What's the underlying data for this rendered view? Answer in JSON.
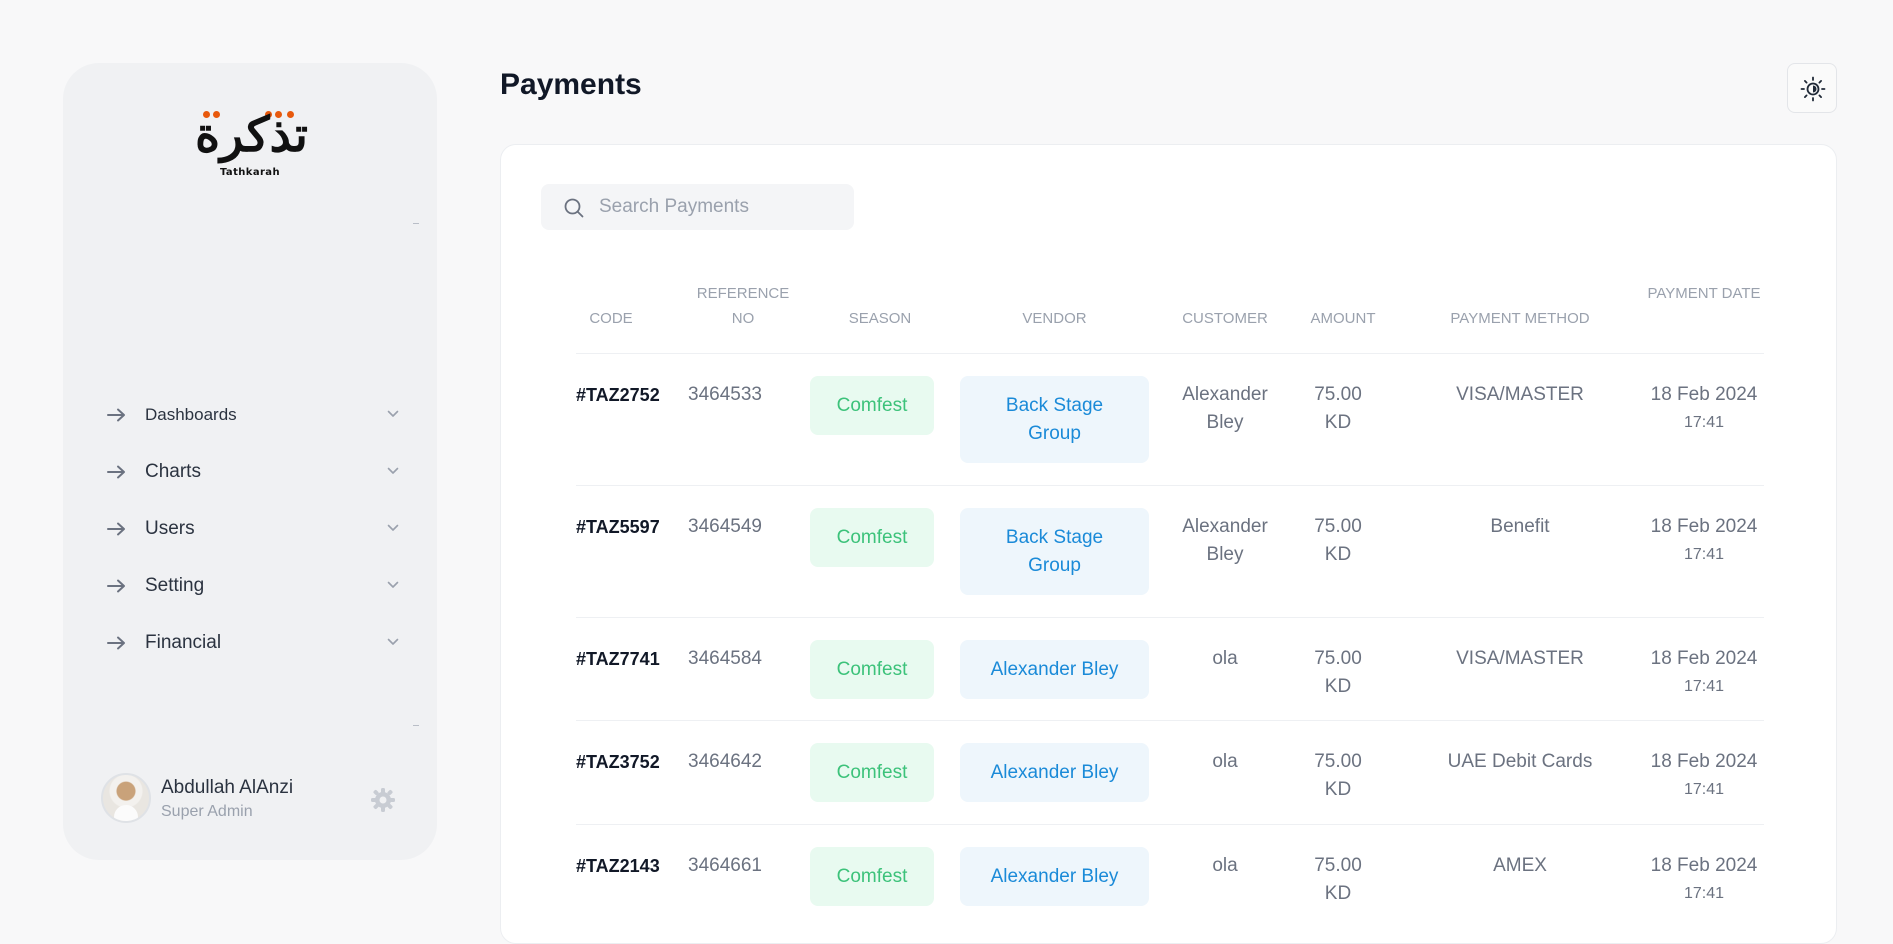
{
  "brand": {
    "logo_word": "تذكرة",
    "logo_sub": "Tathkarah"
  },
  "sidebar": {
    "items": [
      {
        "label": "Dashboards"
      },
      {
        "label": "Charts"
      },
      {
        "label": "Users"
      },
      {
        "label": "Setting"
      },
      {
        "label": "Financial"
      }
    ]
  },
  "user": {
    "name": "Abdullah AlAnzi",
    "role": "Super Admin"
  },
  "page": {
    "title": "Payments"
  },
  "search": {
    "placeholder": "Search Payments",
    "value": ""
  },
  "table": {
    "headers": [
      "CODE",
      "REFERENCE NO",
      "SEASON",
      "VENDOR",
      "CUSTOMER",
      "AMOUNT",
      "PAYMENT METHOD",
      "PAYMENT DATE"
    ],
    "rows": [
      {
        "code": "#TAZ2752",
        "ref": "3464533",
        "season": "Comfest",
        "vendor": "Back Stage Group",
        "customer": "Alexander Bley",
        "amount": "75.00 KD",
        "method": "VISA/MASTER",
        "date": "18 Feb 2024",
        "time": "17:41"
      },
      {
        "code": "#TAZ5597",
        "ref": "3464549",
        "season": "Comfest",
        "vendor": "Back Stage Group",
        "customer": "Alexander Bley",
        "amount": "75.00 KD",
        "method": "Benefit",
        "date": "18 Feb 2024",
        "time": "17:41"
      },
      {
        "code": "#TAZ7741",
        "ref": "3464584",
        "season": "Comfest",
        "vendor": "Alexander Bley",
        "customer": "ola",
        "amount": "75.00 KD",
        "method": "VISA/MASTER",
        "date": "18 Feb 2024",
        "time": "17:41"
      },
      {
        "code": "#TAZ3752",
        "ref": "3464642",
        "season": "Comfest",
        "vendor": "Alexander Bley",
        "customer": "ola",
        "amount": "75.00 KD",
        "method": "UAE Debit Cards",
        "date": "18 Feb 2024",
        "time": "17:41"
      },
      {
        "code": "#TAZ2143",
        "ref": "3464661",
        "season": "Comfest",
        "vendor": "Alexander Bley",
        "customer": "ola",
        "amount": "75.00 KD",
        "method": "AMEX",
        "date": "18 Feb 2024",
        "time": "17:41"
      }
    ]
  },
  "icons": {
    "nav_arrow": "arrow-right-icon",
    "nav_chevron": "chevron-down-icon",
    "search": "search-icon",
    "theme": "sun-icon",
    "user_settings": "gear-icon"
  },
  "colors": {
    "accent_logo": "#e8590c",
    "season_bg": "#e8faf0",
    "season_text": "#3cc27a",
    "vendor_bg": "#eef6fc",
    "vendor_text": "#1a8ad8"
  }
}
